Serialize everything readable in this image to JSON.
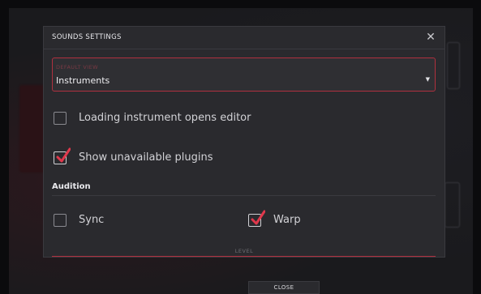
{
  "dialog": {
    "title": "SOUNDS SETTINGS",
    "close_icon": "close-icon"
  },
  "default_view": {
    "label": "DEFAULT VIEW",
    "value": "Instruments",
    "caret_icon": "caret-down-icon"
  },
  "options": {
    "loading_opens_editor": {
      "label": "Loading instrument opens editor",
      "checked": false
    },
    "show_unavailable_plugins": {
      "label": "Show unavailable plugins",
      "checked": true
    }
  },
  "audition": {
    "title": "Audition",
    "sync": {
      "label": "Sync",
      "checked": false
    },
    "warp": {
      "label": "Warp",
      "checked": true
    },
    "level_label": "LEVEL"
  },
  "footer": {
    "close_label": "CLOSE"
  },
  "colors": {
    "accent": "#b0303f",
    "check": "#e0384c",
    "dialog_bg": "#2a2a2e",
    "page_bg": "#0b0b0d"
  }
}
